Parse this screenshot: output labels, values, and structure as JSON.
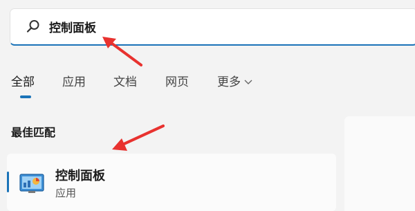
{
  "search": {
    "value": "控制面板",
    "icon": "search-icon"
  },
  "tabs": [
    {
      "label": "全部",
      "active": true
    },
    {
      "label": "应用"
    },
    {
      "label": "文档"
    },
    {
      "label": "网页"
    },
    {
      "label": "更多"
    }
  ],
  "best_match": {
    "title": "最佳匹配",
    "item": {
      "name": "控制面板",
      "type": "应用",
      "icon": "control-panel-icon"
    }
  },
  "colors": {
    "accent": "#1a73b8",
    "annotation_arrow": "#e8322f"
  }
}
